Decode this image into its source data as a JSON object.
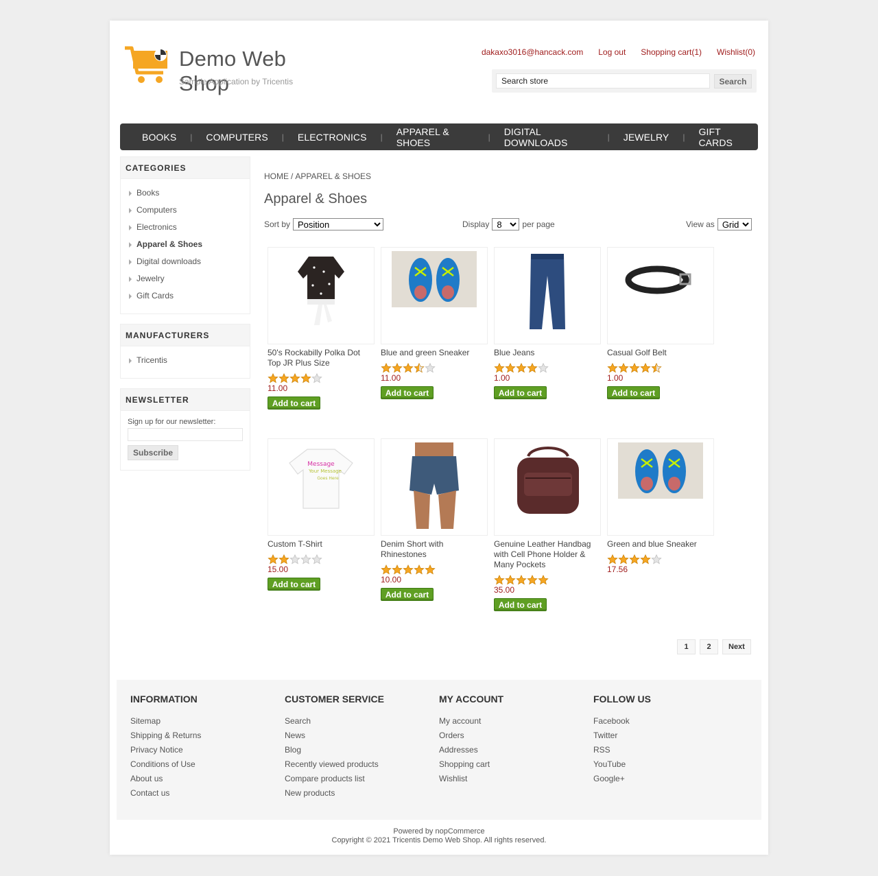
{
  "header": {
    "brand": "Demo Web Shop",
    "tagline": "Sample Application by Tricentis",
    "links": [
      "dakaxo3016@hancack.com",
      "Log out",
      "Shopping cart(1)",
      "Wishlist(0)"
    ],
    "search_placeholder": "Search store",
    "search_button": "Search"
  },
  "menu": [
    "BOOKS",
    "COMPUTERS",
    "ELECTRONICS",
    "APPAREL & SHOES",
    "DIGITAL DOWNLOADS",
    "JEWELRY",
    "GIFT CARDS"
  ],
  "categories": {
    "title": "CATEGORIES",
    "items": [
      "Books",
      "Computers",
      "Electronics",
      "Apparel & Shoes",
      "Digital downloads",
      "Jewelry",
      "Gift Cards"
    ],
    "active": "Apparel & Shoes"
  },
  "manufacturers": {
    "title": "MANUFACTURERS",
    "items": [
      "Tricentis"
    ]
  },
  "newsletter": {
    "title": "NEWSLETTER",
    "label": "Sign up for our newsletter:",
    "button": "Subscribe"
  },
  "breadcrumb": {
    "home": "HOME",
    "current": "APPAREL & SHOES"
  },
  "page_title": "Apparel & Shoes",
  "controls": {
    "sort_label": "Sort by",
    "sort_value": "Position",
    "display_label": "Display",
    "display_value": "8",
    "per_page": "per page",
    "view_label": "View as",
    "view_value": "Grid"
  },
  "add_to_cart": "Add to cart",
  "products": [
    {
      "name": "50's Rockabilly Polka Dot Top JR Plus Size",
      "rating": 4,
      "price": "11.00",
      "image": "polka-top"
    },
    {
      "name": "Blue and green Sneaker",
      "rating": 3.5,
      "price": "11.00",
      "image": "sneaker"
    },
    {
      "name": "Blue Jeans",
      "rating": 4,
      "price": "1.00",
      "image": "jeans"
    },
    {
      "name": "Casual Golf Belt",
      "rating": 4.5,
      "price": "1.00",
      "image": "belt"
    },
    {
      "name": "Custom T-Shirt",
      "rating": 2,
      "price": "15.00",
      "image": "tshirt"
    },
    {
      "name": "Denim Short with Rhinestones",
      "rating": 5,
      "price": "10.00",
      "image": "shorts"
    },
    {
      "name": "Genuine Leather Handbag with Cell Phone Holder & Many Pockets",
      "rating": 5,
      "price": "35.00",
      "image": "handbag"
    },
    {
      "name": "Green and blue Sneaker",
      "rating": 4,
      "price": "17.56",
      "image": "sneaker",
      "no_button": true
    }
  ],
  "pager": [
    "1",
    "2",
    "Next"
  ],
  "footer": {
    "columns": [
      {
        "title": "INFORMATION",
        "items": [
          "Sitemap",
          "Shipping & Returns",
          "Privacy Notice",
          "Conditions of Use",
          "About us",
          "Contact us"
        ]
      },
      {
        "title": "CUSTOMER SERVICE",
        "items": [
          "Search",
          "News",
          "Blog",
          "Recently viewed products",
          "Compare products list",
          "New products"
        ]
      },
      {
        "title": "MY ACCOUNT",
        "items": [
          "My account",
          "Orders",
          "Addresses",
          "Shopping cart",
          "Wishlist"
        ]
      },
      {
        "title": "FOLLOW US",
        "items": [
          "Facebook",
          "Twitter",
          "RSS",
          "YouTube",
          "Google+"
        ]
      }
    ],
    "powered": "Powered by nopCommerce",
    "copyright": "Copyright © 2021 Tricentis Demo Web Shop. All rights reserved."
  },
  "colors": {
    "accent_red": "#a01e1e",
    "menu_bg": "#3b3b3b",
    "button_green": "#5f9f23",
    "star": "#f5a623"
  }
}
